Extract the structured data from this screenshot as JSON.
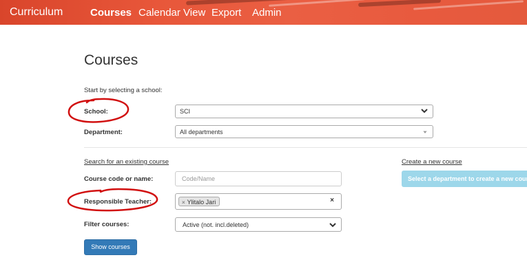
{
  "navbar": {
    "brand": "Curriculum",
    "links": [
      "Courses",
      "Calendar View",
      "Export",
      "Admin"
    ],
    "active": "Courses",
    "color": "#e8573a"
  },
  "page": {
    "title": "Courses",
    "intro": "Start by selecting a school:"
  },
  "school": {
    "label": "School:",
    "value": "SCI"
  },
  "department": {
    "label": "Department:",
    "value": "All departments"
  },
  "search": {
    "link": "Search for an existing course",
    "code_label": "Course code or name:",
    "code_placeholder": "Code/Name",
    "teacher_label": "Responsible Teacher:",
    "teacher_tag": "Ylitalo Jari",
    "clear_symbol": "×",
    "remove_symbol": "×",
    "filter_label": "Filter courses:",
    "filter_value": "Active (not. incl.deleted)",
    "show_button": "Show courses"
  },
  "create": {
    "link": "Create a new course",
    "button": "Select a department to create a new course"
  },
  "colors": {
    "primary": "#337ab7",
    "disabled_button": "#9dd7ea",
    "annotation": "#d10f0f"
  }
}
